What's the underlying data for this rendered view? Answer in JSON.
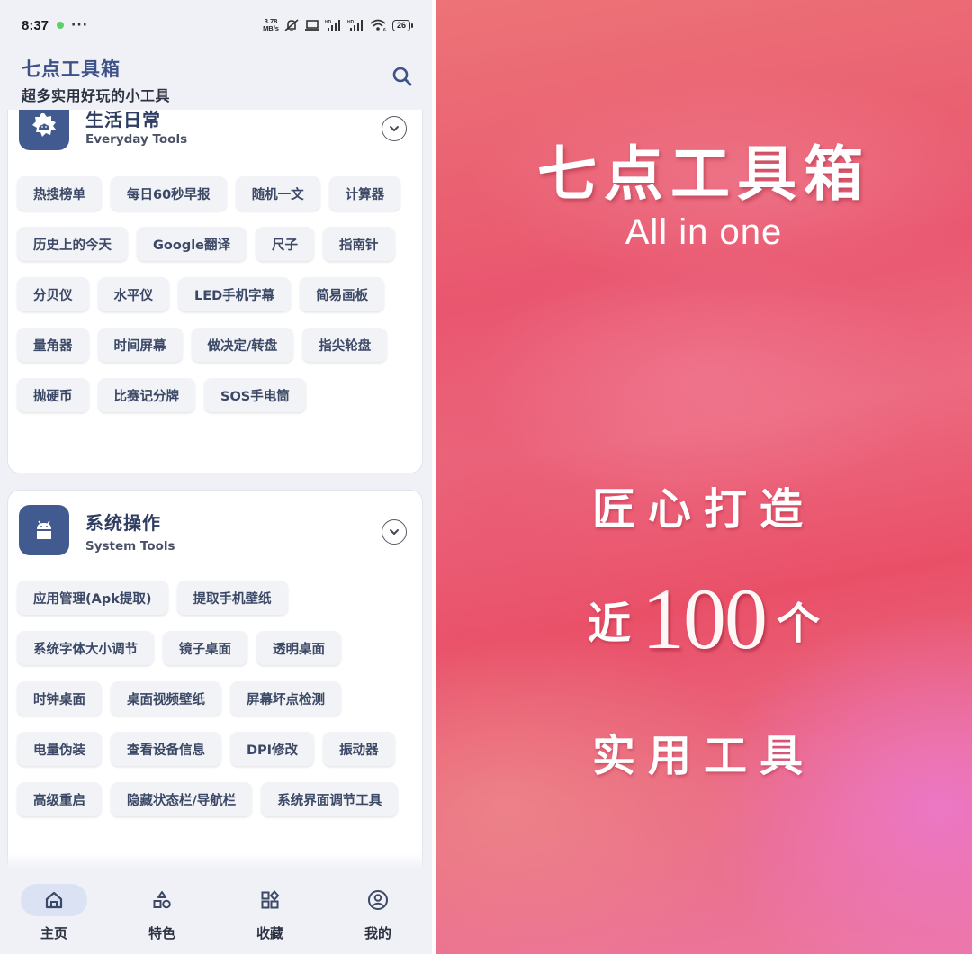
{
  "status_bar": {
    "time": "8:37",
    "more": "···",
    "network_speed_value": "3.78",
    "network_speed_unit": "MB/s",
    "signal1_label": "HD",
    "signal2_label": "HD",
    "wifi_label": "6",
    "battery": "26"
  },
  "app_bar": {
    "title": "七点工具箱",
    "subtitle": "超多实用好玩的小工具",
    "search_icon": "search-icon"
  },
  "categories": [
    {
      "title": "生活日常",
      "subtitle": "Everyday Tools",
      "icon": "sun-cloud-icon",
      "tools": [
        "热搜榜单",
        "每日60秒早报",
        "随机一文",
        "计算器",
        "历史上的今天",
        "Google翻译",
        "尺子",
        "指南针",
        "分贝仪",
        "水平仪",
        "LED手机字幕",
        "简易画板",
        "量角器",
        "时间屏幕",
        "做决定/转盘",
        "指尖轮盘",
        "抛硬币",
        "比赛记分牌",
        "SOS手电筒"
      ]
    },
    {
      "title": "系统操作",
      "subtitle": "System Tools",
      "icon": "android-icon",
      "tools": [
        "应用管理(Apk提取)",
        "提取手机壁纸",
        "系统字体大小调节",
        "镜子桌面",
        "透明桌面",
        "时钟桌面",
        "桌面视频壁纸",
        "屏幕坏点检测",
        "电量伪装",
        "查看设备信息",
        "DPI修改",
        "振动器",
        "高级重启",
        "隐藏状态栏/导航栏",
        "系统界面调节工具"
      ]
    }
  ],
  "bottom_nav": [
    {
      "label": "主页",
      "icon": "home-icon",
      "active": true
    },
    {
      "label": "特色",
      "icon": "shapes-icon",
      "active": false
    },
    {
      "label": "收藏",
      "icon": "grid-diamond-icon",
      "active": false
    },
    {
      "label": "我的",
      "icon": "profile-icon",
      "active": false
    }
  ],
  "promo": {
    "title": "七点工具箱",
    "subtitle": "All in one",
    "line1": "匠心打造",
    "line2_prefix": "近",
    "line2_number": "100",
    "line2_suffix": "个",
    "line3": "实用工具"
  },
  "colors": {
    "accent": "#415a8f",
    "title_blue": "#3e5289",
    "chip_bg": "#f2f3f6",
    "chip_text": "#3b4866",
    "nav_active_bg": "#dbe2f4",
    "promo_red": "#e9566f",
    "promo_pink": "#ec77a0"
  }
}
